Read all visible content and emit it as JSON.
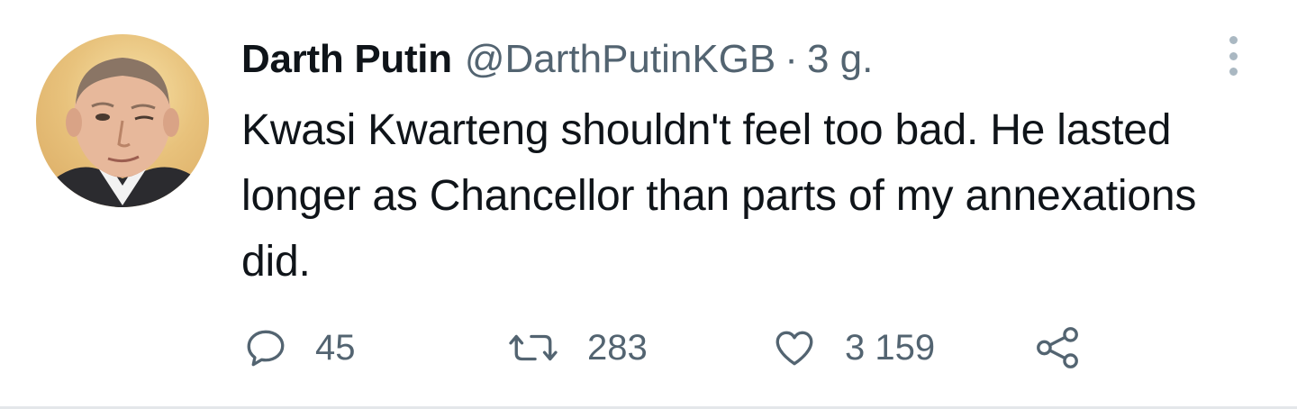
{
  "author": {
    "display_name": "Darth Putin",
    "handle": "@DarthPutinKGB",
    "separator": "·",
    "timestamp": "3 g."
  },
  "tweet": {
    "text": "Kwasi Kwarteng shouldn't feel too bad. He lasted longer as Chancellor than parts of my annexations did."
  },
  "actions": {
    "reply": {
      "icon": "reply-icon",
      "count": "45"
    },
    "retweet": {
      "icon": "retweet-icon",
      "count": "283"
    },
    "like": {
      "icon": "heart-icon",
      "count": "3 159"
    },
    "share": {
      "icon": "share-icon"
    }
  },
  "menu": {
    "icon": "more-options-icon"
  },
  "colors": {
    "text_primary": "#0f1419",
    "text_secondary": "#536471",
    "more_dots": "#aab8c2"
  }
}
